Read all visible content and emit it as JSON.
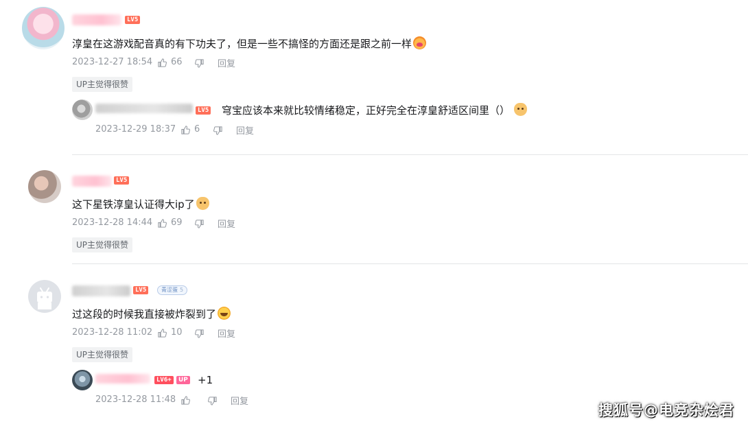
{
  "comments": [
    {
      "level": "LV5",
      "content": "淳皇在这游戏配音真的有下功夫了，但是一些不搞怪的方面还是跟之前一样",
      "time": "2023-12-27 18:54",
      "likes": "66",
      "reply_label": "回复",
      "up_liked": "UP主觉得很赞",
      "replies": [
        {
          "level": "LV5",
          "content": "穹宝应该本来就比较情绪稳定，正好完全在淳皇舒适区间里（）",
          "time": "2023-12-29 18:37",
          "likes": "6",
          "reply_label": "回复"
        }
      ]
    },
    {
      "level": "LV5",
      "content": "这下星铁淳皇认证得大ip了",
      "time": "2023-12-28 14:44",
      "likes": "69",
      "reply_label": "回复",
      "up_liked": "UP主觉得很赞"
    },
    {
      "level": "LV5",
      "fan_badge": "青涩蛋",
      "fan_level": "5",
      "content": "过这段的时候我直接被炸裂到了",
      "time": "2023-12-28 11:02",
      "likes": "10",
      "reply_label": "回复",
      "up_liked": "UP主觉得很赞",
      "replies": [
        {
          "level": "LV6+",
          "up_badge": "UP",
          "content": "+1",
          "time": "2023-12-28 11:48",
          "reply_label": "回复"
        }
      ]
    }
  ],
  "watermark": "搜狐号@电竞杂烩君",
  "icons": {
    "like": "thumb-up-icon",
    "dislike": "thumb-down-icon"
  },
  "colors": {
    "meta_text": "#9499a0",
    "level_badge": "#ff6f59",
    "up_badge": "#ff6699"
  }
}
